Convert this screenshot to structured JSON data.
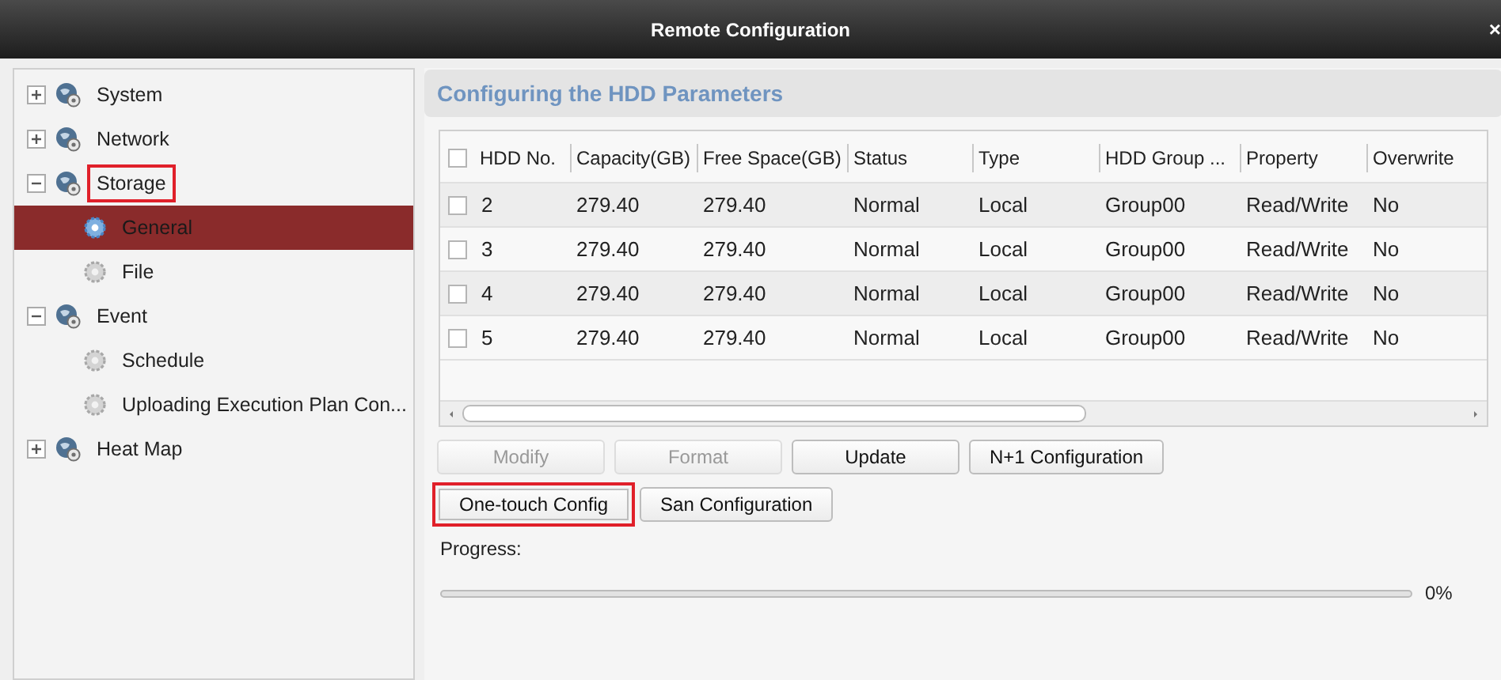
{
  "window": {
    "title": "Remote Configuration",
    "close": "×"
  },
  "tree": [
    {
      "label": "System",
      "expanded": false,
      "selected": false,
      "highlighted": false
    },
    {
      "label": "Network",
      "expanded": false,
      "selected": false,
      "highlighted": false
    },
    {
      "label": "Storage",
      "expanded": true,
      "selected": false,
      "highlighted": true,
      "children": [
        {
          "label": "General",
          "selected": true,
          "highlighted": false
        },
        {
          "label": "File",
          "selected": false,
          "highlighted": false
        }
      ]
    },
    {
      "label": "Event",
      "expanded": true,
      "selected": false,
      "highlighted": false,
      "children": [
        {
          "label": "Schedule",
          "selected": false,
          "highlighted": false
        },
        {
          "label": "Uploading Execution Plan Con...",
          "selected": false,
          "highlighted": false
        }
      ]
    },
    {
      "label": "Heat Map",
      "expanded": false,
      "selected": false,
      "highlighted": false
    }
  ],
  "panel_title": "Configuring the HDD Parameters",
  "table": {
    "all_checked": false,
    "columns": [
      "HDD No.",
      "Capacity(GB)",
      "Free Space(GB)",
      "Status",
      "Type",
      "HDD Group ...",
      "Property",
      "Overwrite"
    ],
    "rows": [
      {
        "checked": false,
        "cells": [
          "2",
          "279.40",
          "279.40",
          "Normal",
          "Local",
          "Group00",
          "Read/Write",
          "No"
        ]
      },
      {
        "checked": false,
        "cells": [
          "3",
          "279.40",
          "279.40",
          "Normal",
          "Local",
          "Group00",
          "Read/Write",
          "No"
        ]
      },
      {
        "checked": false,
        "cells": [
          "4",
          "279.40",
          "279.40",
          "Normal",
          "Local",
          "Group00",
          "Read/Write",
          "No"
        ]
      },
      {
        "checked": false,
        "cells": [
          "5",
          "279.40",
          "279.40",
          "Normal",
          "Local",
          "Group00",
          "Read/Write",
          "No"
        ]
      }
    ]
  },
  "buttons": [
    [
      {
        "label": "Modify",
        "disabled": true,
        "highlighted": false
      },
      {
        "label": "Format",
        "disabled": true,
        "highlighted": false
      },
      {
        "label": "Update",
        "disabled": false,
        "highlighted": false
      },
      {
        "label": "N+1 Configuration",
        "disabled": false,
        "highlighted": false
      }
    ],
    [
      {
        "label": "One-touch Config",
        "disabled": false,
        "highlighted": true
      },
      {
        "label": "San Configuration",
        "disabled": false,
        "highlighted": false
      }
    ]
  ],
  "progress": {
    "label": "Progress:",
    "level": 0,
    "reading": "0%"
  }
}
